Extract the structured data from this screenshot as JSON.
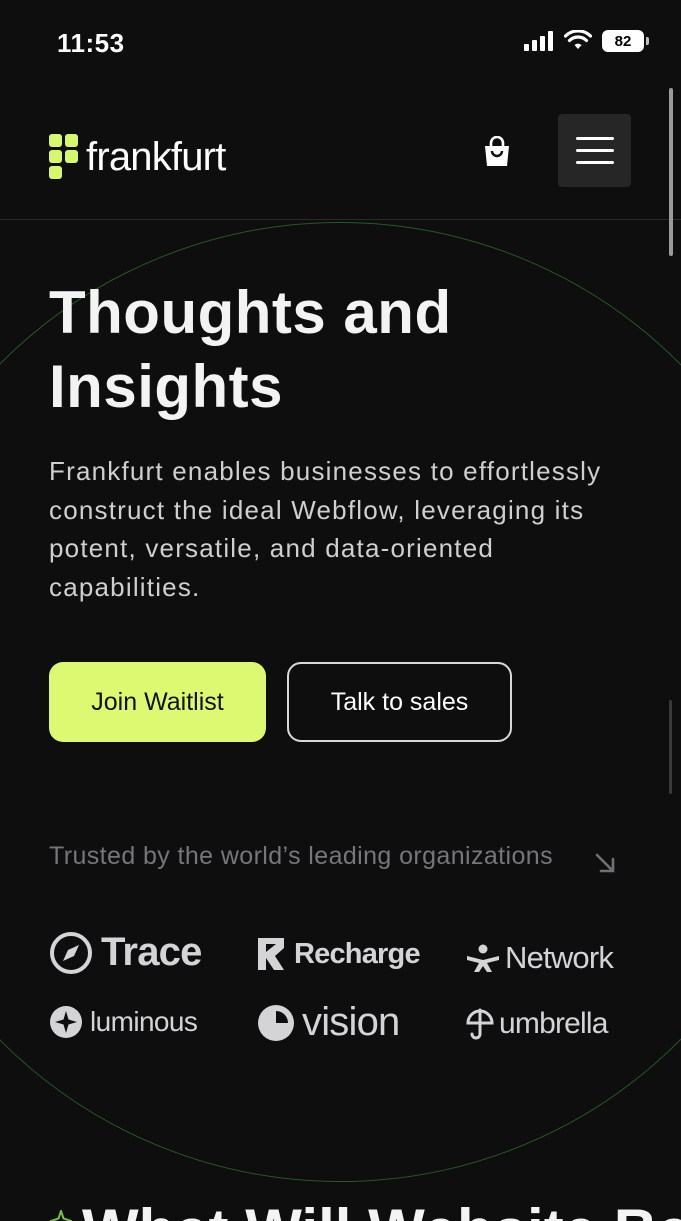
{
  "status_bar": {
    "time": "11:53",
    "battery": "82"
  },
  "header": {
    "logo_text": "frankfurt"
  },
  "hero": {
    "title_line1": "Thoughts and",
    "title_line2": "Insights",
    "description": "Frankfurt enables businesses to effortlessly construct the ideal Webflow, leveraging its potent, versatile, and data-oriented capabilities.",
    "primary_button": "Join Waitlist",
    "secondary_button": "Talk to sales"
  },
  "trusted": {
    "text": "Trusted by the world’s leading organizations",
    "brands": [
      {
        "name": "Trace"
      },
      {
        "name": "Recharge"
      },
      {
        "name": "Network"
      },
      {
        "name": "luminous"
      },
      {
        "name": "vision"
      },
      {
        "name": "umbrella"
      }
    ]
  },
  "next_section": {
    "title_partial": "What Will Website Be"
  },
  "colors": {
    "accent": "#dcf971",
    "background": "#0e0e0e",
    "circle": "#3c963c"
  }
}
